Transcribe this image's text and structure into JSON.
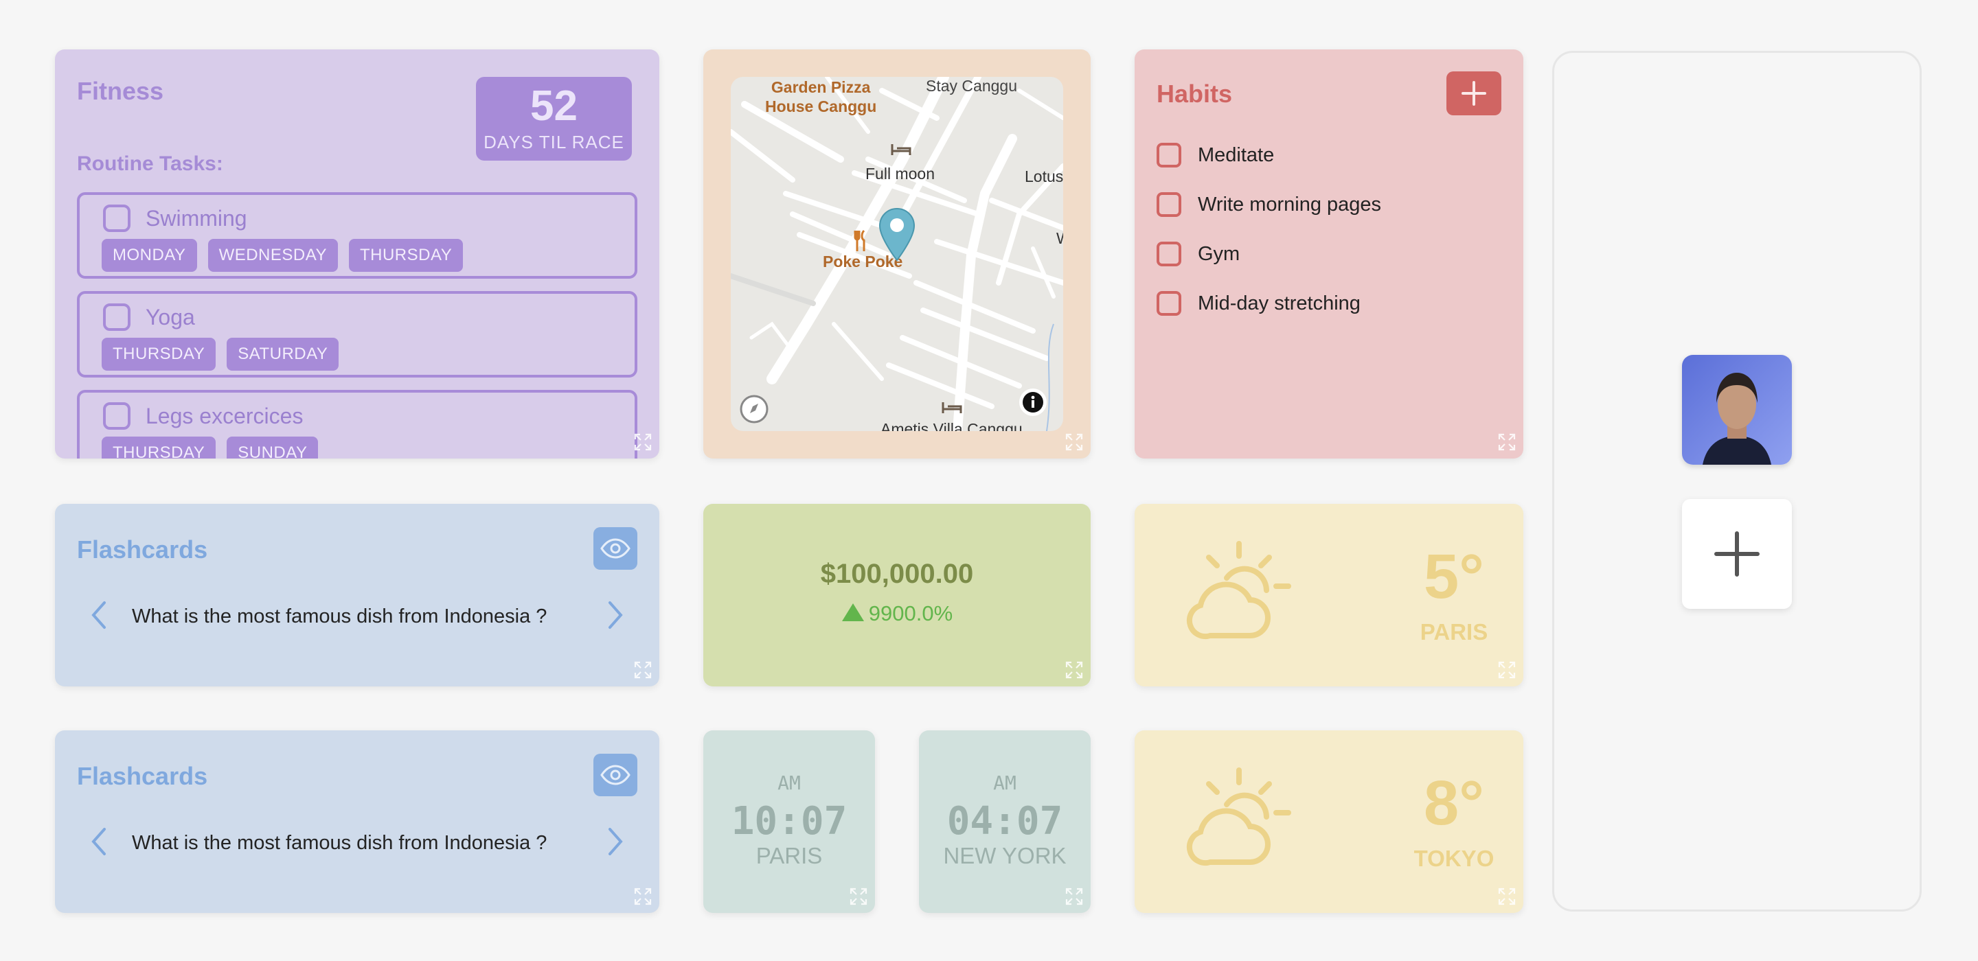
{
  "fitness": {
    "title": "Fitness",
    "race_days": "52",
    "race_label": "DAYS TIL RACE",
    "routine_label": "Routine Tasks:",
    "tasks": [
      {
        "name": "Swimming",
        "days": [
          "MONDAY",
          "WEDNESDAY",
          "THURSDAY"
        ]
      },
      {
        "name": "Yoga",
        "days": [
          "THURSDAY",
          "SATURDAY"
        ]
      },
      {
        "name": "Legs excercices",
        "days": [
          "THURSDAY",
          "SUNDAY"
        ]
      }
    ]
  },
  "map": {
    "labels": {
      "garden": "Garden Pizza\nHouse Canggu",
      "stay": "Stay Canggu",
      "fullmoon": "Full moon",
      "lotus": "Lotus",
      "poke": "Poke Poke",
      "villa": "Ametis Villa Canggu",
      "w": "W"
    }
  },
  "habits": {
    "title": "Habits",
    "items": [
      "Meditate",
      "Write morning pages",
      "Gym",
      "Mid-day stretching"
    ]
  },
  "flashcards": [
    {
      "title": "Flashcards",
      "question": "What is the most famous dish from Indonesia ?"
    },
    {
      "title": "Flashcards",
      "question": "What is the most famous dish from Indonesia ?"
    }
  ],
  "money": {
    "amount": "$100,000.00",
    "change": "9900.0%"
  },
  "weather": [
    {
      "temp": "5°",
      "city": "PARIS"
    },
    {
      "temp": "8°",
      "city": "TOKYO"
    }
  ],
  "clocks": [
    {
      "ampm": "AM",
      "time": "10:07",
      "city": "PARIS"
    },
    {
      "ampm": "AM",
      "time": "04:07",
      "city": "NEW YORK"
    }
  ],
  "colors": {
    "fitness": "#d8ccea",
    "map": "#f1dcc9",
    "habits": "#edc9ca",
    "flashcards": "#cfdbeb",
    "money": "#d5dfae",
    "weather": "#f6eccb",
    "clock": "#d1e1dd"
  },
  "icons": [
    "expand-icon",
    "plus-icon",
    "eye-icon",
    "chevron-left-icon",
    "chevron-right-icon",
    "weather-sun-cloud-icon",
    "info-icon",
    "map-pin-icon",
    "bed-icon",
    "restaurant-icon",
    "compass-icon",
    "triangle-up-icon"
  ]
}
